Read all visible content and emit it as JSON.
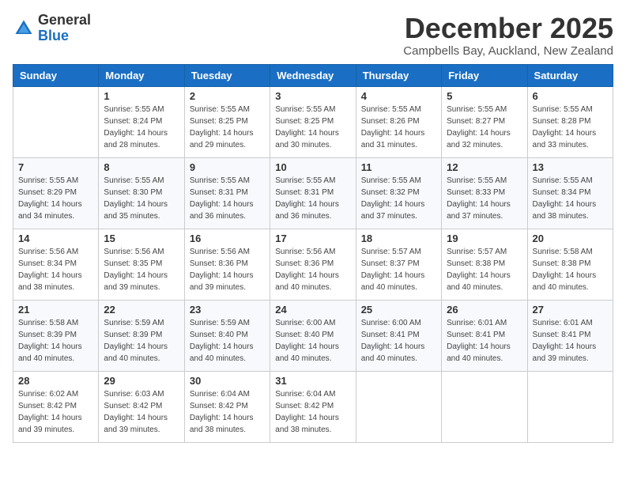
{
  "header": {
    "logo_general": "General",
    "logo_blue": "Blue",
    "month_title": "December 2025",
    "location": "Campbells Bay, Auckland, New Zealand"
  },
  "days_of_week": [
    "Sunday",
    "Monday",
    "Tuesday",
    "Wednesday",
    "Thursday",
    "Friday",
    "Saturday"
  ],
  "weeks": [
    [
      {
        "day": "",
        "sunrise": "",
        "sunset": "",
        "daylight": ""
      },
      {
        "day": "1",
        "sunrise": "Sunrise: 5:55 AM",
        "sunset": "Sunset: 8:24 PM",
        "daylight": "Daylight: 14 hours and 28 minutes."
      },
      {
        "day": "2",
        "sunrise": "Sunrise: 5:55 AM",
        "sunset": "Sunset: 8:25 PM",
        "daylight": "Daylight: 14 hours and 29 minutes."
      },
      {
        "day": "3",
        "sunrise": "Sunrise: 5:55 AM",
        "sunset": "Sunset: 8:25 PM",
        "daylight": "Daylight: 14 hours and 30 minutes."
      },
      {
        "day": "4",
        "sunrise": "Sunrise: 5:55 AM",
        "sunset": "Sunset: 8:26 PM",
        "daylight": "Daylight: 14 hours and 31 minutes."
      },
      {
        "day": "5",
        "sunrise": "Sunrise: 5:55 AM",
        "sunset": "Sunset: 8:27 PM",
        "daylight": "Daylight: 14 hours and 32 minutes."
      },
      {
        "day": "6",
        "sunrise": "Sunrise: 5:55 AM",
        "sunset": "Sunset: 8:28 PM",
        "daylight": "Daylight: 14 hours and 33 minutes."
      }
    ],
    [
      {
        "day": "7",
        "sunrise": "Sunrise: 5:55 AM",
        "sunset": "Sunset: 8:29 PM",
        "daylight": "Daylight: 14 hours and 34 minutes."
      },
      {
        "day": "8",
        "sunrise": "Sunrise: 5:55 AM",
        "sunset": "Sunset: 8:30 PM",
        "daylight": "Daylight: 14 hours and 35 minutes."
      },
      {
        "day": "9",
        "sunrise": "Sunrise: 5:55 AM",
        "sunset": "Sunset: 8:31 PM",
        "daylight": "Daylight: 14 hours and 36 minutes."
      },
      {
        "day": "10",
        "sunrise": "Sunrise: 5:55 AM",
        "sunset": "Sunset: 8:31 PM",
        "daylight": "Daylight: 14 hours and 36 minutes."
      },
      {
        "day": "11",
        "sunrise": "Sunrise: 5:55 AM",
        "sunset": "Sunset: 8:32 PM",
        "daylight": "Daylight: 14 hours and 37 minutes."
      },
      {
        "day": "12",
        "sunrise": "Sunrise: 5:55 AM",
        "sunset": "Sunset: 8:33 PM",
        "daylight": "Daylight: 14 hours and 37 minutes."
      },
      {
        "day": "13",
        "sunrise": "Sunrise: 5:55 AM",
        "sunset": "Sunset: 8:34 PM",
        "daylight": "Daylight: 14 hours and 38 minutes."
      }
    ],
    [
      {
        "day": "14",
        "sunrise": "Sunrise: 5:56 AM",
        "sunset": "Sunset: 8:34 PM",
        "daylight": "Daylight: 14 hours and 38 minutes."
      },
      {
        "day": "15",
        "sunrise": "Sunrise: 5:56 AM",
        "sunset": "Sunset: 8:35 PM",
        "daylight": "Daylight: 14 hours and 39 minutes."
      },
      {
        "day": "16",
        "sunrise": "Sunrise: 5:56 AM",
        "sunset": "Sunset: 8:36 PM",
        "daylight": "Daylight: 14 hours and 39 minutes."
      },
      {
        "day": "17",
        "sunrise": "Sunrise: 5:56 AM",
        "sunset": "Sunset: 8:36 PM",
        "daylight": "Daylight: 14 hours and 40 minutes."
      },
      {
        "day": "18",
        "sunrise": "Sunrise: 5:57 AM",
        "sunset": "Sunset: 8:37 PM",
        "daylight": "Daylight: 14 hours and 40 minutes."
      },
      {
        "day": "19",
        "sunrise": "Sunrise: 5:57 AM",
        "sunset": "Sunset: 8:38 PM",
        "daylight": "Daylight: 14 hours and 40 minutes."
      },
      {
        "day": "20",
        "sunrise": "Sunrise: 5:58 AM",
        "sunset": "Sunset: 8:38 PM",
        "daylight": "Daylight: 14 hours and 40 minutes."
      }
    ],
    [
      {
        "day": "21",
        "sunrise": "Sunrise: 5:58 AM",
        "sunset": "Sunset: 8:39 PM",
        "daylight": "Daylight: 14 hours and 40 minutes."
      },
      {
        "day": "22",
        "sunrise": "Sunrise: 5:59 AM",
        "sunset": "Sunset: 8:39 PM",
        "daylight": "Daylight: 14 hours and 40 minutes."
      },
      {
        "day": "23",
        "sunrise": "Sunrise: 5:59 AM",
        "sunset": "Sunset: 8:40 PM",
        "daylight": "Daylight: 14 hours and 40 minutes."
      },
      {
        "day": "24",
        "sunrise": "Sunrise: 6:00 AM",
        "sunset": "Sunset: 8:40 PM",
        "daylight": "Daylight: 14 hours and 40 minutes."
      },
      {
        "day": "25",
        "sunrise": "Sunrise: 6:00 AM",
        "sunset": "Sunset: 8:41 PM",
        "daylight": "Daylight: 14 hours and 40 minutes."
      },
      {
        "day": "26",
        "sunrise": "Sunrise: 6:01 AM",
        "sunset": "Sunset: 8:41 PM",
        "daylight": "Daylight: 14 hours and 40 minutes."
      },
      {
        "day": "27",
        "sunrise": "Sunrise: 6:01 AM",
        "sunset": "Sunset: 8:41 PM",
        "daylight": "Daylight: 14 hours and 39 minutes."
      }
    ],
    [
      {
        "day": "28",
        "sunrise": "Sunrise: 6:02 AM",
        "sunset": "Sunset: 8:42 PM",
        "daylight": "Daylight: 14 hours and 39 minutes."
      },
      {
        "day": "29",
        "sunrise": "Sunrise: 6:03 AM",
        "sunset": "Sunset: 8:42 PM",
        "daylight": "Daylight: 14 hours and 39 minutes."
      },
      {
        "day": "30",
        "sunrise": "Sunrise: 6:04 AM",
        "sunset": "Sunset: 8:42 PM",
        "daylight": "Daylight: 14 hours and 38 minutes."
      },
      {
        "day": "31",
        "sunrise": "Sunrise: 6:04 AM",
        "sunset": "Sunset: 8:42 PM",
        "daylight": "Daylight: 14 hours and 38 minutes."
      },
      {
        "day": "",
        "sunrise": "",
        "sunset": "",
        "daylight": ""
      },
      {
        "day": "",
        "sunrise": "",
        "sunset": "",
        "daylight": ""
      },
      {
        "day": "",
        "sunrise": "",
        "sunset": "",
        "daylight": ""
      }
    ]
  ]
}
